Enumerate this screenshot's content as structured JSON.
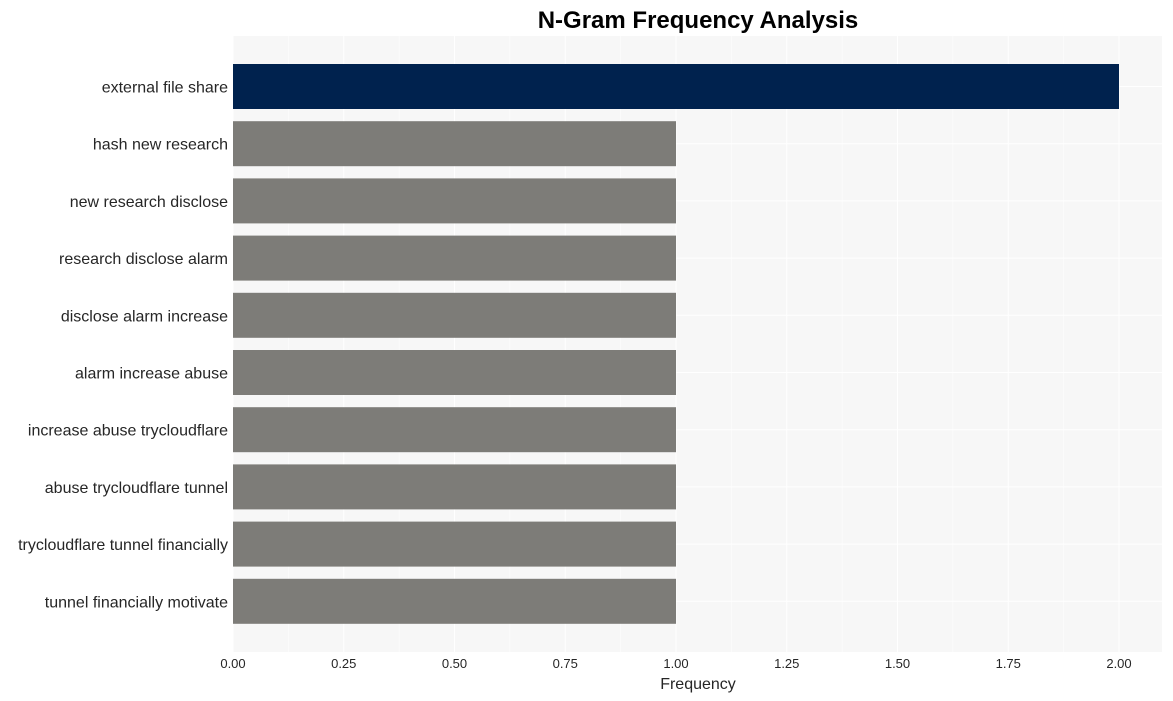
{
  "chart_data": {
    "type": "bar",
    "orientation": "horizontal",
    "title": "N-Gram Frequency Analysis",
    "xlabel": "Frequency",
    "ylabel": "",
    "xlim": [
      0,
      2.1
    ],
    "xticks": [
      0,
      0.25,
      0.5,
      0.75,
      1.0,
      1.25,
      1.5,
      1.75,
      2.0
    ],
    "xtick_labels": [
      "0.00",
      "0.25",
      "0.50",
      "0.75",
      "1.00",
      "1.25",
      "1.50",
      "1.75",
      "2.00"
    ],
    "grid": true,
    "legend": "none",
    "categories": [
      "external file share",
      "hash new research",
      "new research disclose",
      "research disclose alarm",
      "disclose alarm increase",
      "alarm increase abuse",
      "increase abuse trycloudflare",
      "abuse trycloudflare tunnel",
      "trycloudflare tunnel financially",
      "tunnel financially motivate"
    ],
    "values": [
      2,
      1,
      1,
      1,
      1,
      1,
      1,
      1,
      1,
      1
    ],
    "colors": {
      "highlight": "#00224e",
      "default": "#7d7c78",
      "plot_background": "#f7f7f7",
      "grid": "#ffffff"
    }
  }
}
